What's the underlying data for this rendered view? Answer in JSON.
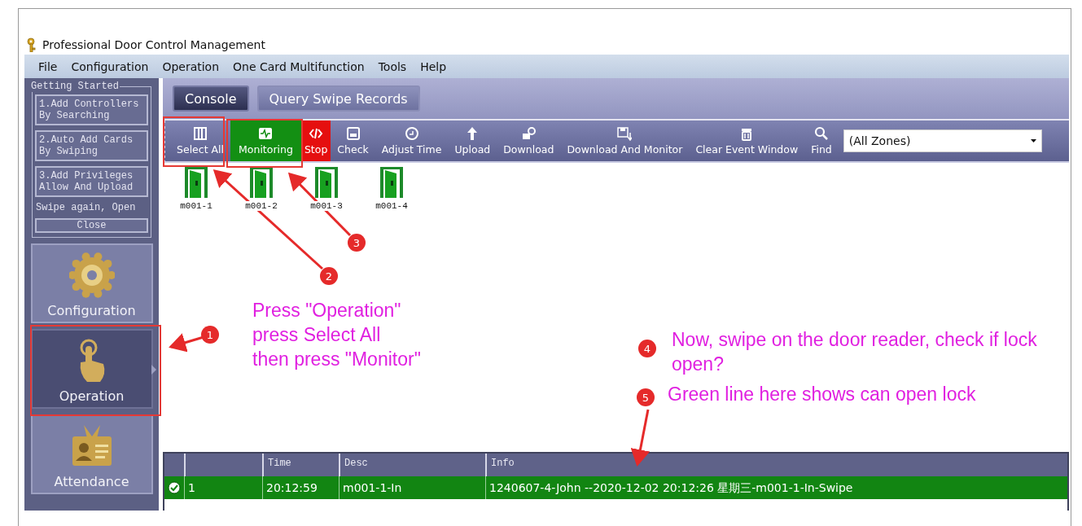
{
  "window": {
    "title": "Professional Door Control Management"
  },
  "menu": [
    "File",
    "Configuration",
    "Operation",
    "One Card Multifunction",
    "Tools",
    "Help"
  ],
  "getting_started": {
    "title": "Getting Started",
    "steps": [
      "1.Add Controllers By Searching",
      "2.Auto Add Cards By Swiping",
      "3.Add Privileges Allow And Upload"
    ],
    "hint": "Swipe again, Open",
    "close": "Close"
  },
  "nav": [
    {
      "label": "Configuration",
      "selected": false
    },
    {
      "label": "Operation",
      "selected": true
    },
    {
      "label": "Attendance",
      "selected": false
    }
  ],
  "tabs": [
    {
      "label": "Console",
      "selected": true
    },
    {
      "label": "Query Swipe Records",
      "selected": false
    }
  ],
  "toolbar": [
    {
      "label": "Select All",
      "kind": "plain"
    },
    {
      "label": "Monitoring",
      "kind": "active"
    },
    {
      "label": "Stop",
      "kind": "alert"
    },
    {
      "label": "Check",
      "kind": "plain"
    },
    {
      "label": "Adjust Time",
      "kind": "plain"
    },
    {
      "label": "Upload",
      "kind": "plain"
    },
    {
      "label": "Download",
      "kind": "plain"
    },
    {
      "label": "Download And Monitor",
      "kind": "plain"
    },
    {
      "label": "Clear Event Window",
      "kind": "plain"
    },
    {
      "label": "Find",
      "kind": "plain"
    }
  ],
  "zone_select": {
    "value": "(All Zones)"
  },
  "doors": [
    "m001-1",
    "m001-2",
    "m001-3",
    "m001-4"
  ],
  "events": {
    "columns": [
      "",
      "Time",
      "Desc",
      "Info"
    ],
    "rows": [
      {
        "success": true,
        "cells": [
          "1",
          "20:12:59",
          "m001-1-In",
          "1240607-4-John --2020-12-02 20:12:26 星期三-m001-1-In-Swipe"
        ]
      }
    ]
  },
  "annotations": {
    "markers": [
      "1",
      "2",
      "3",
      "4",
      "5"
    ],
    "instruction": [
      "Press \"Operation\"",
      "press Select All",
      "then press \"Monitor\""
    ],
    "notes": [
      "Now, swipe on the door reader, check if lock open?",
      "Green line here shows can open lock"
    ]
  }
}
